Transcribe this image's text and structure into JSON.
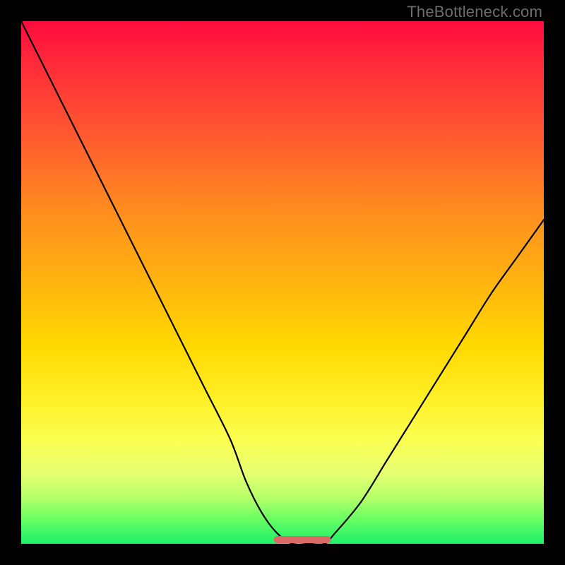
{
  "watermark": "TheBottleneck.com",
  "chart_data": {
    "type": "line",
    "title": "",
    "xlabel": "",
    "ylabel": "",
    "xlim": [
      0,
      100
    ],
    "ylim": [
      0,
      100
    ],
    "x": [
      0,
      5,
      10,
      15,
      20,
      25,
      30,
      35,
      40,
      43,
      46,
      49,
      52,
      55,
      58,
      60,
      65,
      70,
      75,
      80,
      85,
      90,
      95,
      100
    ],
    "values": [
      100,
      90,
      80,
      70,
      60,
      50,
      40,
      30,
      20,
      12,
      6,
      2,
      0,
      0,
      0,
      2,
      8,
      16,
      24,
      32,
      40,
      48,
      55,
      62
    ],
    "series": [
      {
        "name": "curve",
        "color": "#000000",
        "values": [
          100,
          90,
          80,
          70,
          60,
          50,
          40,
          30,
          20,
          12,
          6,
          2,
          0,
          0,
          0,
          2,
          8,
          16,
          24,
          32,
          40,
          48,
          55,
          62
        ]
      }
    ],
    "annotations": [
      {
        "name": "flat-region-marker",
        "x_start": 49,
        "x_end": 59,
        "y": 0,
        "color": "#d96a66"
      }
    ],
    "gradient_stops": [
      {
        "pos": 0.0,
        "color": "#ff0b3e"
      },
      {
        "pos": 0.5,
        "color": "#ffd800"
      },
      {
        "pos": 0.85,
        "color": "#fbff50"
      },
      {
        "pos": 1.0,
        "color": "#1ef06a"
      }
    ]
  }
}
